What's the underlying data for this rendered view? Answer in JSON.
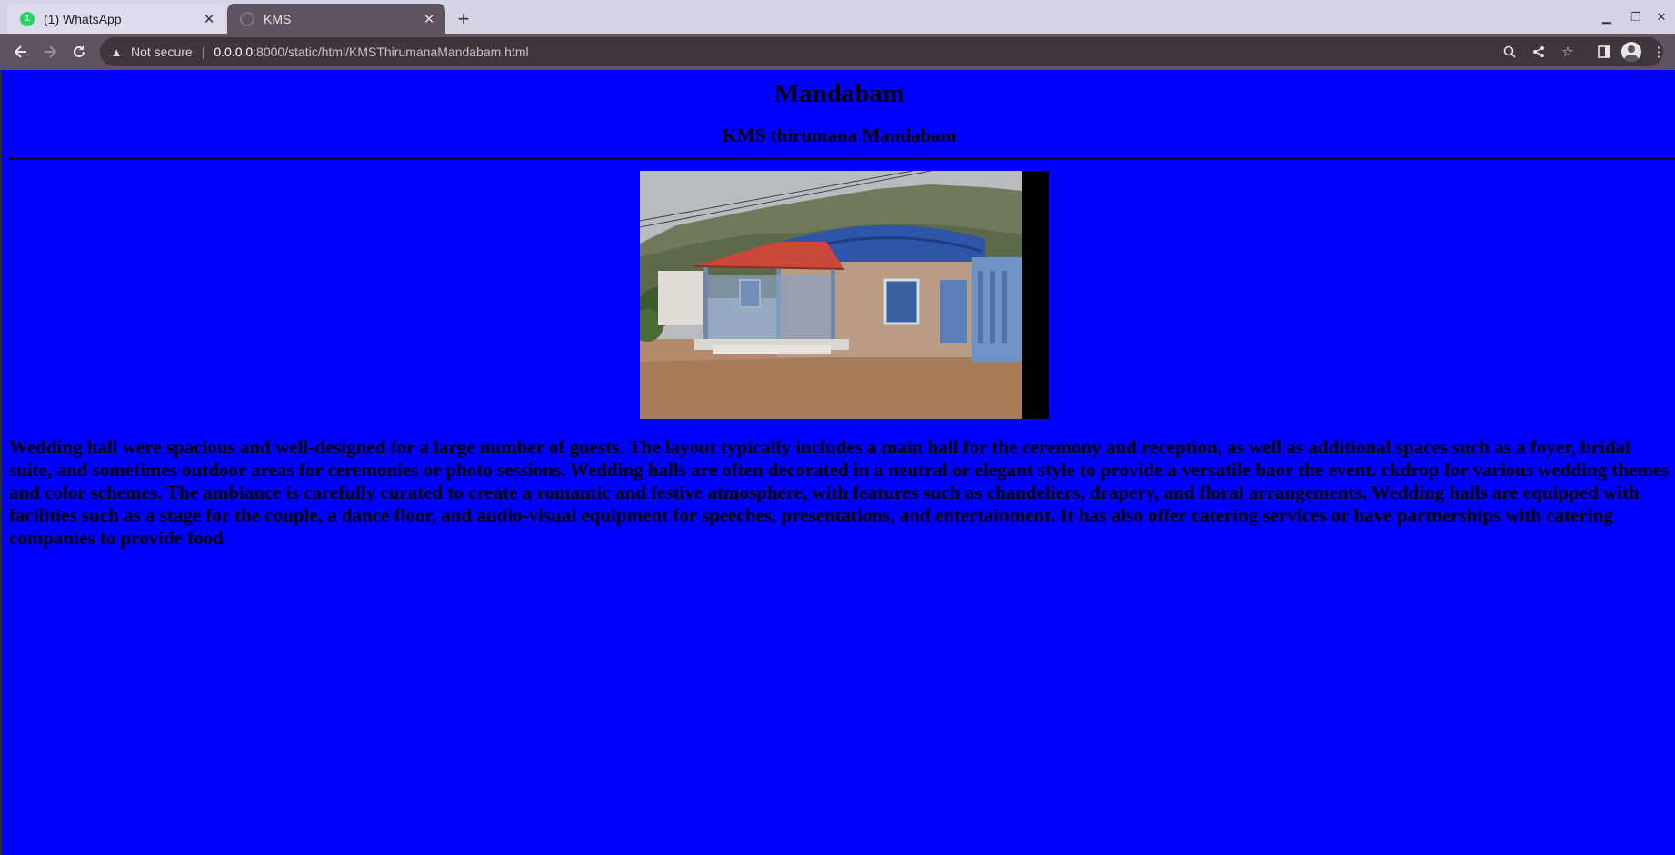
{
  "browser": {
    "tabs": [
      {
        "title": "(1) WhatsApp",
        "badge": "1",
        "icon": "whatsapp-icon",
        "active": false
      },
      {
        "title": "KMS",
        "icon": "page-icon",
        "active": true
      }
    ],
    "omnibox": {
      "security_label": "Not secure",
      "url_host": "0.0.0.0",
      "url_path": ":8000/static/html/KMSThirumanaMandabam.html"
    }
  },
  "page": {
    "heading": "Mandabam",
    "subheading": "KMS thirumana Mandabam",
    "image": {
      "subject": "wedding-hall-photo"
    },
    "description": "Wedding hall were spacious and well-designed for a large number of guests. The layout typically includes a main hall for the ceremony and reception, as well as additional spaces such as a foyer, bridal suite, and sometimes outdoor areas for ceremonies or photo sessions. Wedding halls are often decorated in a neutral or elegant style to provide a versatile baor the event. ckdrop for various wedding themes and color schemes. The ambiance is carefully curated to create a romantic and festive atmosphere, with features such as chandeliers, drapery, and floral arrangements. Wedding halls are equipped with facilities such as a stage for the couple, a dance floor, and audio-visual equipment for speeches, presentations, and entertainment. It has also offer catering services or have partnerships with catering companies to provide food"
  },
  "colors": {
    "page_background": "#0000ff",
    "toolbar": "#5f535f",
    "tabstrip": "#d6d4e4"
  }
}
